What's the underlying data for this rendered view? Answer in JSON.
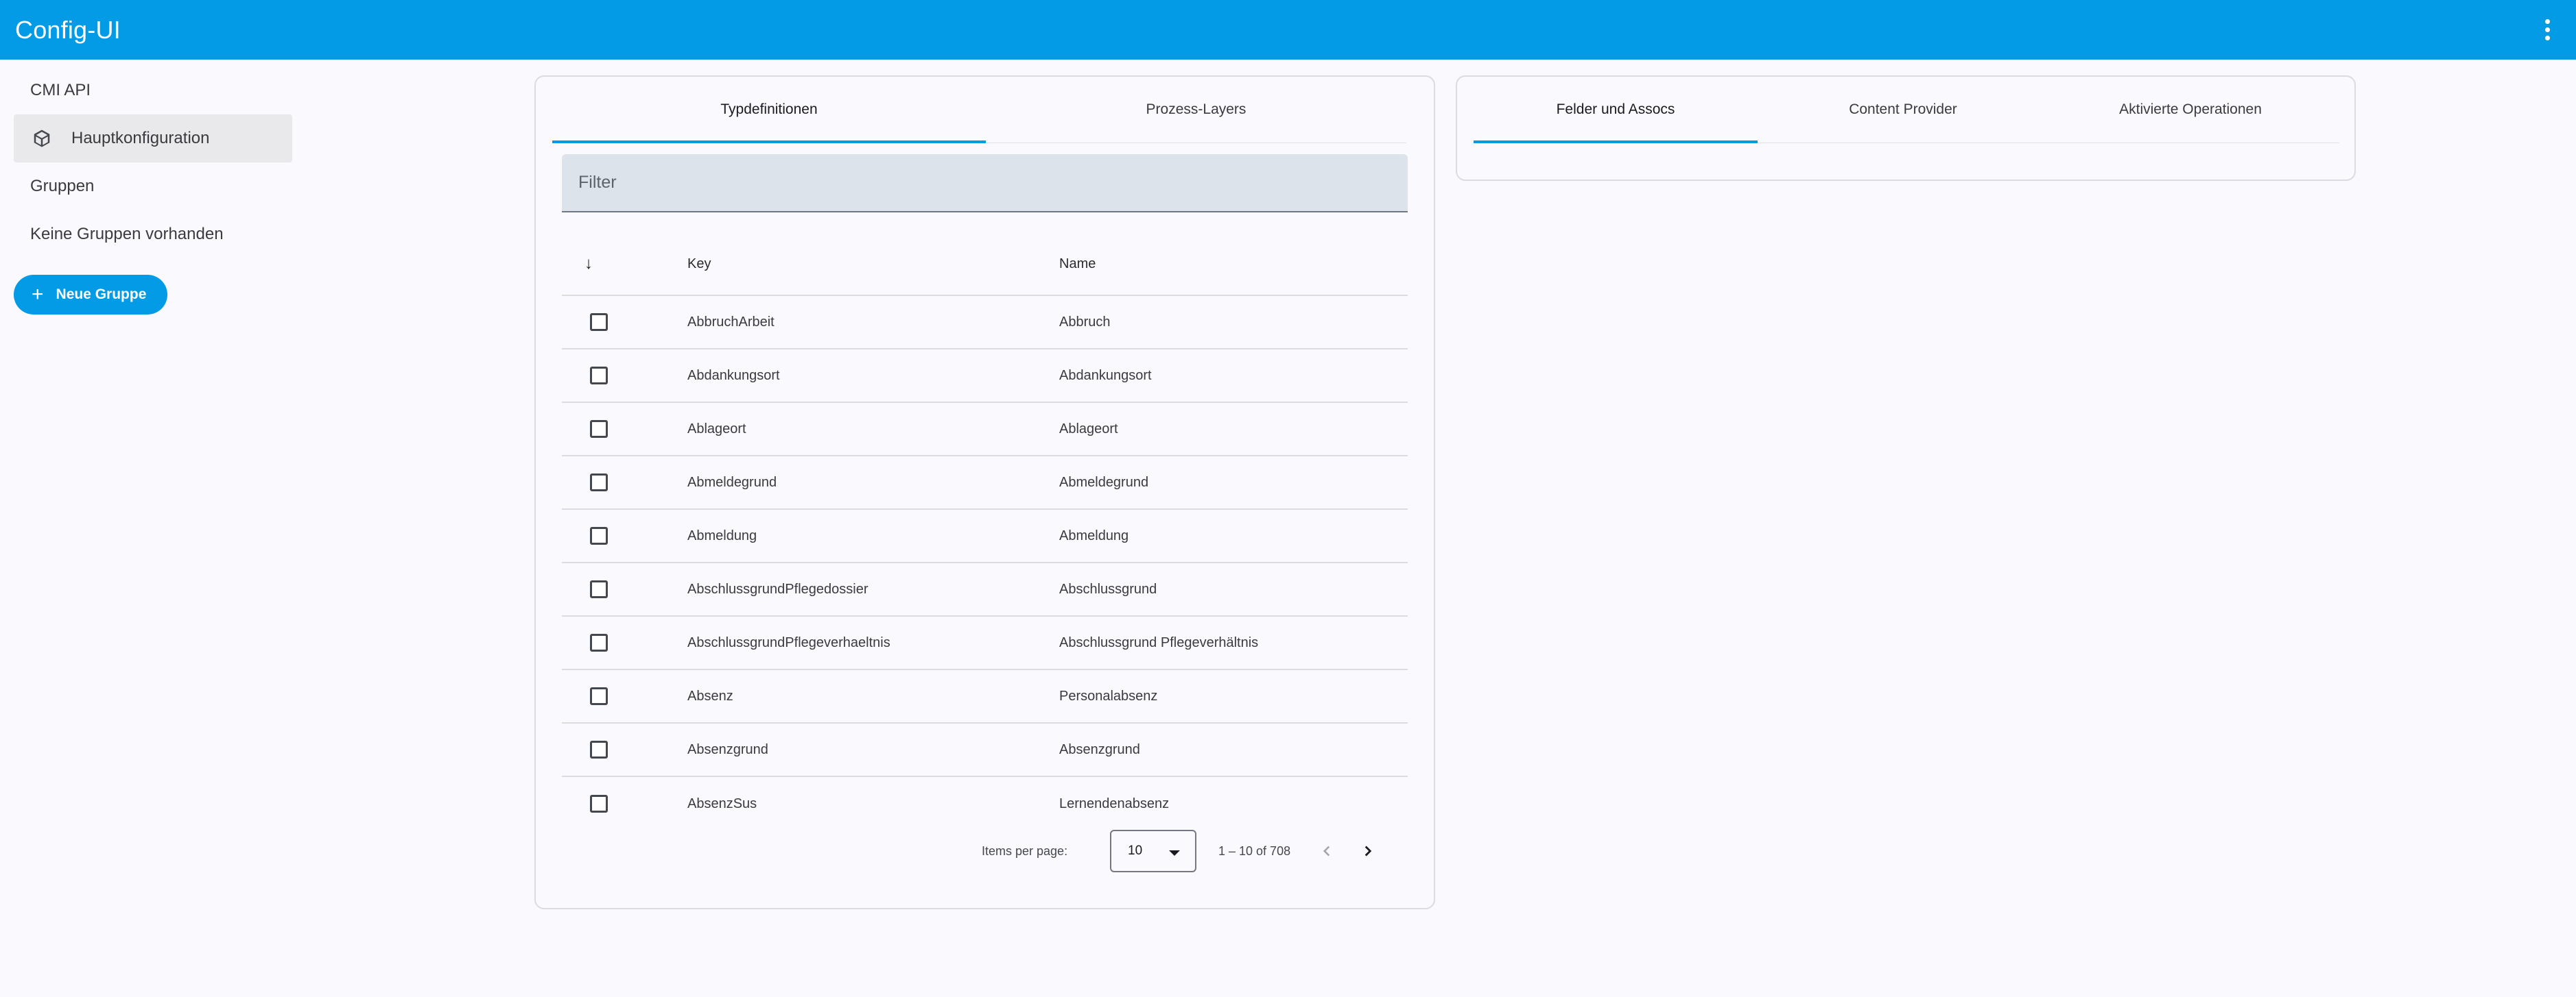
{
  "app": {
    "title": "Config-UI",
    "menu_icon": "more-vert-icon"
  },
  "sidebar": {
    "items": [
      {
        "label": "CMI API",
        "active": false
      },
      {
        "label": "Hauptkonfiguration",
        "active": true,
        "icon": "cube-icon"
      },
      {
        "label": "Gruppen",
        "active": false
      },
      {
        "label": "Keine Gruppen vorhanden",
        "active": false
      }
    ],
    "new_group_button": {
      "label": "Neue Gruppe",
      "icon": "plus-icon"
    }
  },
  "left_card": {
    "tabs": [
      {
        "label": "Typdefinitionen",
        "active": true
      },
      {
        "label": "Prozess-Layers",
        "active": false
      }
    ],
    "filter": {
      "placeholder": "Filter",
      "value": ""
    },
    "table": {
      "sort_icon": "arrow-down-icon",
      "columns": {
        "key": "Key",
        "name": "Name"
      },
      "rows": [
        {
          "key": "AbbruchArbeit",
          "name": "Abbruch",
          "checked": false
        },
        {
          "key": "Abdankungsort",
          "name": "Abdankungsort",
          "checked": false
        },
        {
          "key": "Ablageort",
          "name": "Ablageort",
          "checked": false
        },
        {
          "key": "Abmeldegrund",
          "name": "Abmeldegrund",
          "checked": false
        },
        {
          "key": "Abmeldung",
          "name": "Abmeldung",
          "checked": false
        },
        {
          "key": "AbschlussgrundPflegedossier",
          "name": "Abschlussgrund",
          "checked": false
        },
        {
          "key": "AbschlussgrundPflegeverhaeltnis",
          "name": "Abschlussgrund Pflegeverhältnis",
          "checked": false
        },
        {
          "key": "Absenz",
          "name": "Personalabsenz",
          "checked": false
        },
        {
          "key": "Absenzgrund",
          "name": "Absenzgrund",
          "checked": false
        },
        {
          "key": "AbsenzSus",
          "name": "Lernendenabsenz",
          "checked": false
        }
      ]
    },
    "paginator": {
      "items_per_page_label": "Items per page:",
      "page_size": "10",
      "range_label": "1 – 10 of 708"
    }
  },
  "right_card": {
    "tabs": [
      {
        "label": "Felder und Assocs",
        "active": true
      },
      {
        "label": "Content Provider",
        "active": false
      },
      {
        "label": "Aktivierte Operationen",
        "active": false
      }
    ]
  },
  "colors": {
    "primary": "#039be5",
    "background": "#faf9fd",
    "filter_bg": "#dce3ea"
  }
}
